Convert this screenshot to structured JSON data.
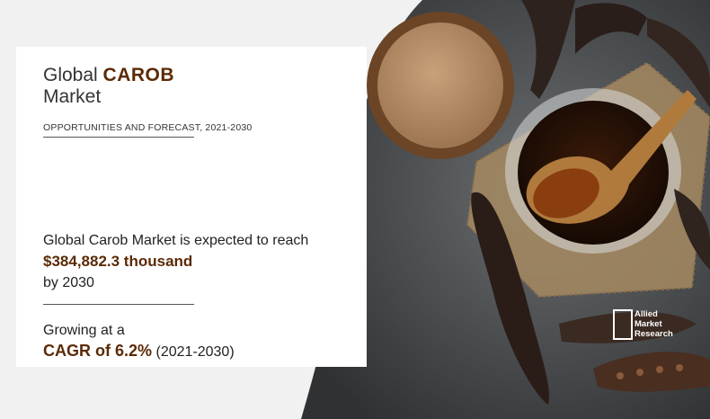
{
  "card": {
    "title_prefix": "Global",
    "title_highlight": "CAROB",
    "title_suffix": "Market",
    "subtitle": "OPPORTUNITIES AND FORECAST, 2021-2030",
    "statement_prefix": "Global Carob Market is expected to reach",
    "statement_value": "$384,882.3 thousand",
    "statement_suffix": "by 2030",
    "growth_prefix": "Growing at a",
    "growth_cagr": "CAGR of 6.2%",
    "growth_period": "(2021-2030)"
  },
  "logo": {
    "line1": "Allied",
    "line2": "Market",
    "line3": "Research"
  },
  "colors": {
    "accent": "#5b2a06",
    "background": "#f1f1f1",
    "stone": "#45484b"
  }
}
